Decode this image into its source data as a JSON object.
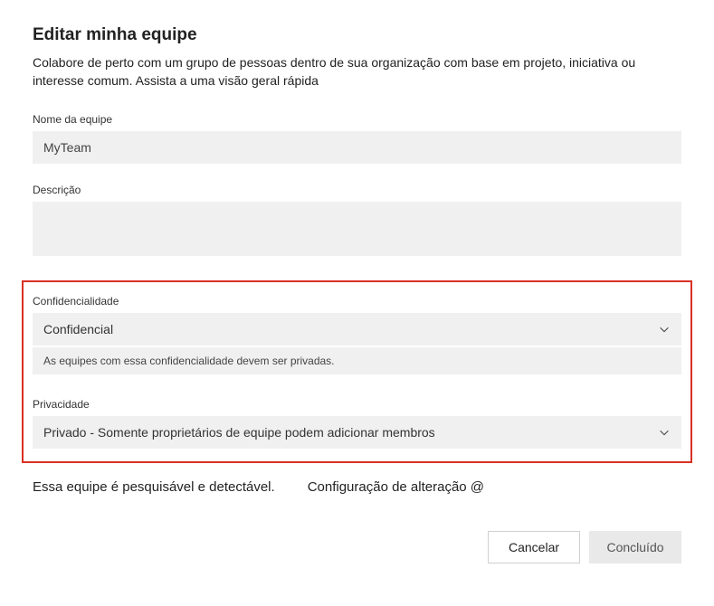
{
  "dialog": {
    "title": "Editar minha equipe",
    "subtitle": "Colabore de perto com um grupo de pessoas dentro de sua organização com base em projeto, iniciativa ou interesse comum. Assista a uma visão geral rápida"
  },
  "fields": {
    "teamName": {
      "label": "Nome da equipe",
      "value": "MyTeam"
    },
    "description": {
      "label": "Descrição",
      "value": ""
    },
    "confidentiality": {
      "label": "Confidencialidade",
      "value": "Confidencial",
      "helper": "As equipes com essa confidencialidade devem ser privadas."
    },
    "privacy": {
      "label": "Privacidade",
      "value": "Privado - Somente proprietários de equipe podem adicionar membros"
    }
  },
  "footer": {
    "searchable": "Essa equipe é pesquisável e detectável.",
    "changeConfig": "Configuração de alteração @"
  },
  "buttons": {
    "cancel": "Cancelar",
    "done": "Concluído"
  }
}
